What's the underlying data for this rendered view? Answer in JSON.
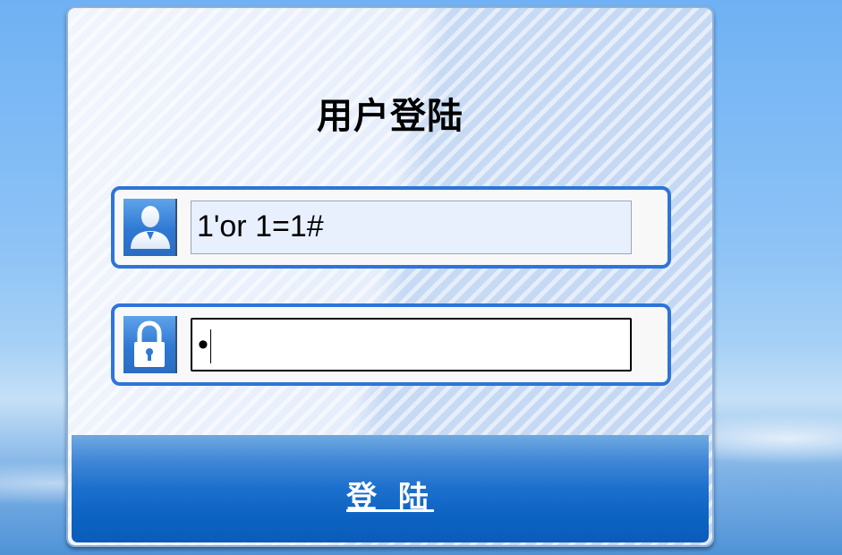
{
  "login_panel": {
    "title": "用户登陆",
    "username": {
      "icon": "user-icon",
      "value": "1'or 1=1#"
    },
    "password": {
      "icon": "lock-icon",
      "masked_value": "•"
    },
    "submit_label": "登 陆"
  },
  "colors": {
    "field_border": "#2f74d8",
    "button_bar": "#0d63c2",
    "autofill_bg": "#e8f0fe"
  }
}
